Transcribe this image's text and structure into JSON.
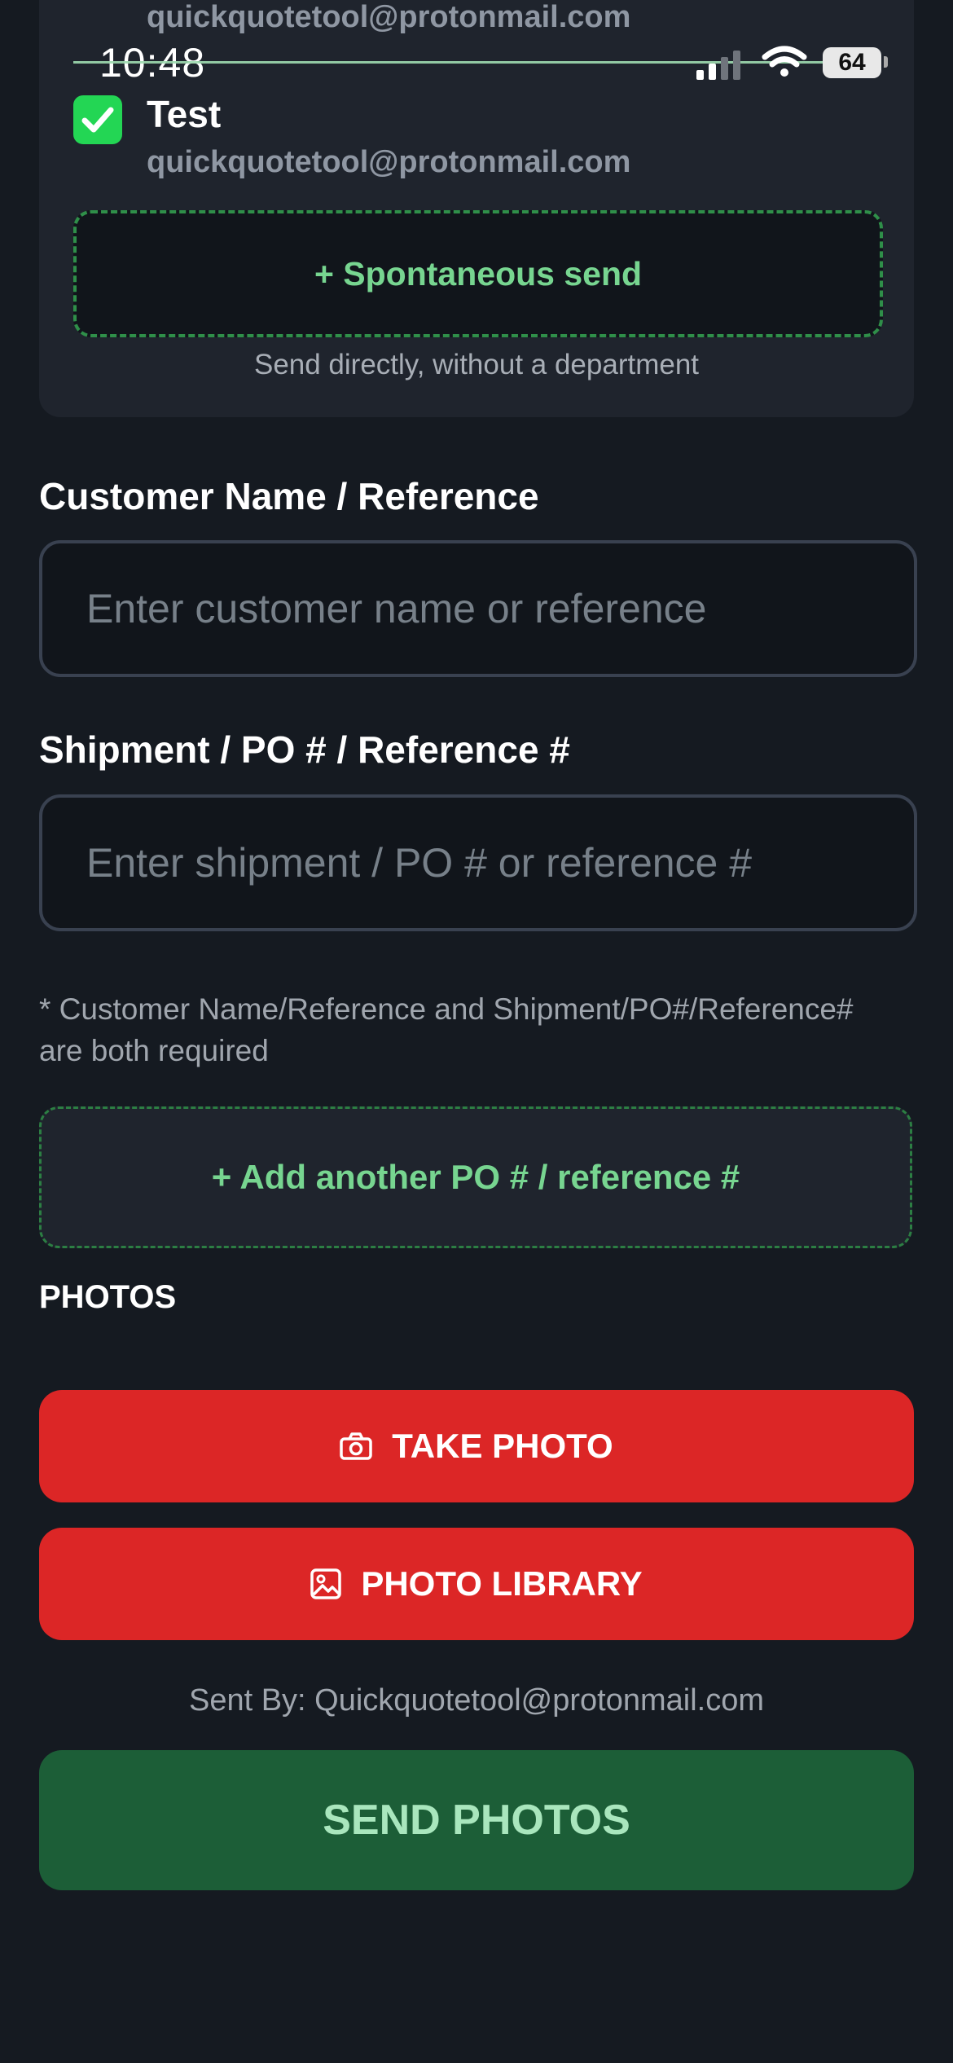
{
  "status_bar": {
    "time": "10:48",
    "battery": "64"
  },
  "recipients": {
    "previous_email": "quickquotetool@protonmail.com",
    "selected_name": "Test",
    "selected_email": "quickquotetool@protonmail.com"
  },
  "spontaneous": {
    "button_label": "+ Spontaneous send",
    "subtitle": "Send directly, without a department"
  },
  "form": {
    "customer_label": "Customer Name / Reference",
    "customer_placeholder": "Enter customer name or reference",
    "shipment_label": "Shipment / PO # / Reference #",
    "shipment_placeholder": "Enter shipment / PO # or reference #",
    "required_note": "* Customer Name/Reference and Shipment/PO#/Reference# are both required",
    "add_po_label": "+ Add another PO # / reference #"
  },
  "photos": {
    "section_label": "PHOTOS",
    "take_photo_label": "TAKE PHOTO",
    "photo_library_label": "PHOTO LIBRARY"
  },
  "footer": {
    "sent_by": "Sent By: Quickquotetool@protonmail.com",
    "send_label": "SEND PHOTOS"
  },
  "colors": {
    "background": "#151a21",
    "card": "#1f242d",
    "accent_green": "#77d590",
    "check_green": "#23d654",
    "red": "#dc2626",
    "send_green": "#1c5e37"
  },
  "icons": [
    "check-icon",
    "camera-icon",
    "image-icon",
    "signal-icon",
    "wifi-icon",
    "battery-icon"
  ]
}
